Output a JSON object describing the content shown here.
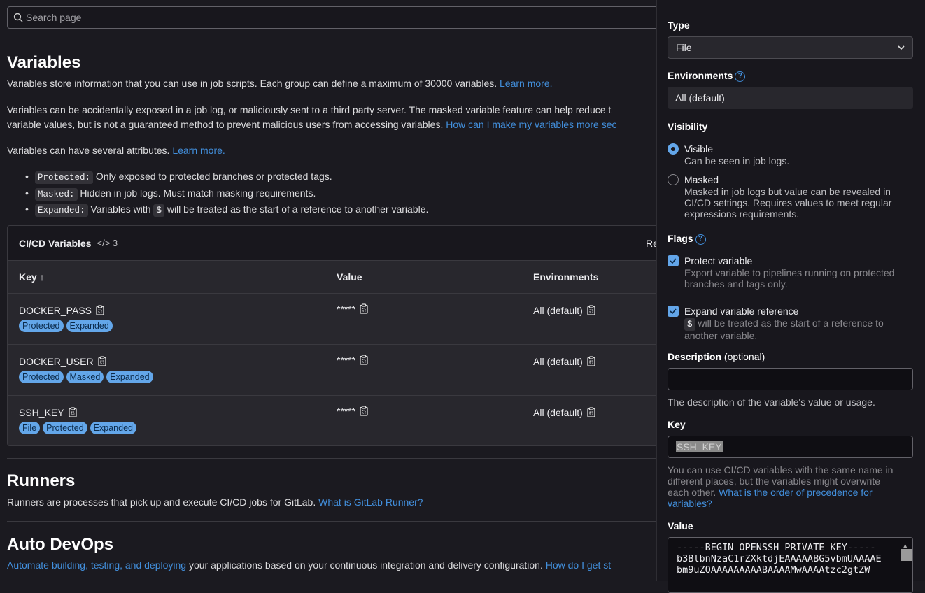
{
  "search": {
    "placeholder": "Search page"
  },
  "variables": {
    "title": "Variables",
    "intro": "Variables store information that you can use in job scripts. Each group can define a maximum of 30000 variables.",
    "intro_link": "Learn more.",
    "warning_line1": "Variables can be accidentally exposed in a job log, or maliciously sent to a third party server. The masked variable feature can help reduce t",
    "warning_line2": "variable values, but is not a guaranteed method to prevent malicious users from accessing variables.",
    "warning_link": "How can I make my variables more sec",
    "attrs": "Variables can have several attributes.",
    "attrs_link": "Learn more.",
    "bullets": [
      {
        "code": "Protected:",
        "text": "Only exposed to protected branches or protected tags."
      },
      {
        "code": "Masked:",
        "text": "Hidden in job logs. Must match masking requirements."
      },
      {
        "code": "Expanded:",
        "text_before": "Variables with",
        "code2": "$",
        "text_after": "will be treated as the start of a reference to another variable."
      }
    ]
  },
  "table": {
    "title": "CI/CD Variables",
    "count": "3",
    "right_action": "Re",
    "columns": {
      "key": "Key",
      "value": "Value",
      "env": "Environments"
    },
    "rows": [
      {
        "key": "DOCKER_PASS",
        "value": "*****",
        "env": "All (default)",
        "badges": [
          "Protected",
          "Expanded"
        ]
      },
      {
        "key": "DOCKER_USER",
        "value": "*****",
        "env": "All (default)",
        "badges": [
          "Protected",
          "Masked",
          "Expanded"
        ]
      },
      {
        "key": "SSH_KEY",
        "value": "*****",
        "env": "All (default)",
        "badges": [
          "File",
          "Protected",
          "Expanded"
        ]
      }
    ]
  },
  "runners": {
    "title": "Runners",
    "text": "Runners are processes that pick up and execute CI/CD jobs for GitLab.",
    "link": "What is GitLab Runner?"
  },
  "autodevops": {
    "title": "Auto DevOps",
    "link1": "Automate building, testing, and deploying",
    "text": "your applications based on your continuous integration and delivery configuration.",
    "link2": "How do I get st"
  },
  "drawer": {
    "type_label": "Type",
    "type_value": "File",
    "env_label": "Environments",
    "env_value": "All (default)",
    "visibility_label": "Visibility",
    "visible": {
      "title": "Visible",
      "desc": "Can be seen in job logs.",
      "selected": true
    },
    "masked": {
      "title": "Masked",
      "desc1": "Masked in job logs but value can be revealed in",
      "desc2": "CI/CD settings. Requires values to meet regular",
      "desc3": "expressions requirements.",
      "selected": false
    },
    "flags_label": "Flags",
    "protect": {
      "title": "Protect variable",
      "desc1": "Export variable to pipelines running on protected",
      "desc2": "branches and tags only.",
      "checked": true
    },
    "expand": {
      "title": "Expand variable reference",
      "code": "$",
      "desc1": "will be treated as the start of a reference to",
      "desc2": "another variable.",
      "checked": true
    },
    "desc_label": "Description",
    "desc_optional": "(optional)",
    "desc_value": "",
    "desc_help": "The description of the variable's value or usage.",
    "key_label": "Key",
    "key_value": "SSH_KEY",
    "key_help1": "You can use CI/CD variables with the same name in",
    "key_help2": "different places, but the variables might overwrite",
    "key_help3": "each other.",
    "key_help_link1": "What is the order of precedence for",
    "key_help_link2": "variables?",
    "value_label": "Value",
    "value_lines": [
      "-----BEGIN OPENSSH PRIVATE KEY-----",
      "b3BlbnNzaC1rZXktdjEAAAAABG5vbmUAAAAE",
      "bm9uZQAAAAAAAAABAAAAMwAAAAtzc2gtZW"
    ]
  },
  "colors": {
    "accent": "#428fdc",
    "badge": "#63a6e9",
    "background": "#1b1a20",
    "drawer": "#18171d"
  }
}
